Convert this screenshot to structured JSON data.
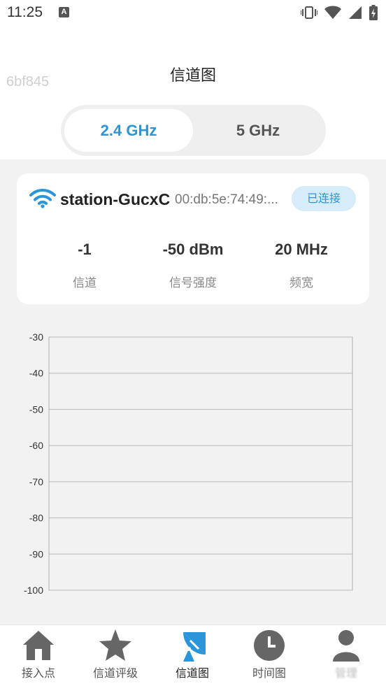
{
  "status_bar": {
    "time": "11:25",
    "notification_icon": "a-icon",
    "icons": [
      "vibrate-icon",
      "wifi-signal-icon",
      "cell-signal-icon",
      "battery-charging-icon"
    ]
  },
  "header": {
    "title": "信道图",
    "watermark": "6bf845"
  },
  "band_toggle": {
    "options": [
      "2.4 GHz",
      "5 GHz"
    ],
    "selected": "2.4 GHz"
  },
  "network": {
    "icon": "wifi-icon",
    "ssid": "station-GucxC",
    "bssid": "00:db:5e:74:49:...",
    "status": "已连接",
    "stats": [
      {
        "value": "-1",
        "label": "信道"
      },
      {
        "value": "-50 dBm",
        "label": "信号强度"
      },
      {
        "value": "20 MHz",
        "label": "频宽"
      }
    ]
  },
  "chart_data": {
    "type": "line",
    "ylim": [
      -100,
      -30
    ],
    "yticks": [
      "-30",
      "-40",
      "-50",
      "-60",
      "-70",
      "-80",
      "-90",
      "-100"
    ],
    "grid": true,
    "series": []
  },
  "bottom_nav": {
    "items": [
      {
        "label": "接入点",
        "icon": "home-icon"
      },
      {
        "label": "信道评级",
        "icon": "star-icon"
      },
      {
        "label": "信道图",
        "icon": "satellite-dish-icon"
      },
      {
        "label": "时间图",
        "icon": "clock-icon"
      },
      {
        "label": "管理",
        "icon": "person-icon"
      }
    ],
    "active": "信道图",
    "colors": {
      "active": "#2a95d8",
      "inactive": "#666666"
    }
  },
  "colors": {
    "accent": "#2a95d8",
    "badge_bg": "#d6ecfb",
    "background": "#f2f2f2"
  }
}
